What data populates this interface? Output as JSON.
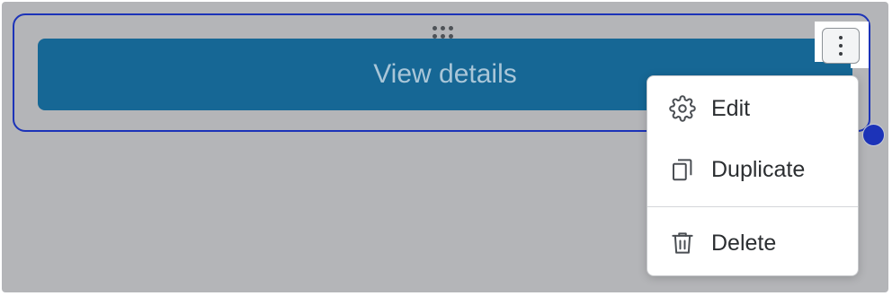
{
  "block": {
    "button_label": "View details"
  },
  "menu": {
    "items": [
      {
        "label": "Edit",
        "icon": "gear-icon"
      },
      {
        "label": "Duplicate",
        "icon": "duplicate-icon"
      },
      {
        "label": "Delete",
        "icon": "trash-icon"
      }
    ]
  },
  "colors": {
    "button": "#166795",
    "selection": "#1c33b8",
    "canvas": "#b4b5b8"
  }
}
